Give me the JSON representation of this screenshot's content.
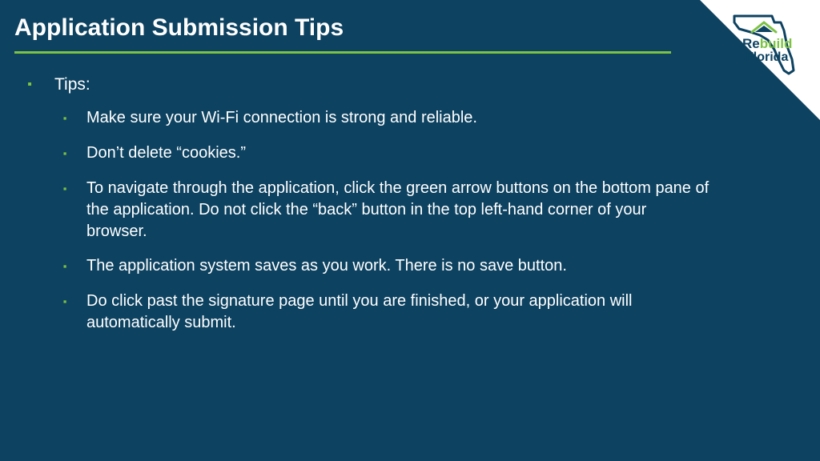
{
  "title": "Application Submission Tips",
  "logo": {
    "line1_a": "Re",
    "line1_b": "build",
    "line2": "Florida"
  },
  "colors": {
    "background": "#0d4261",
    "accent": "#7cc243",
    "text": "#ffffff",
    "logo_dark": "#0d4261",
    "logo_green": "#7cc243"
  },
  "list": {
    "heading": "Tips:",
    "items": [
      "Make sure your Wi-Fi connection is strong and reliable.",
      "Don’t delete “cookies.”",
      "To navigate through the application, click the green arrow buttons on the bottom pane of the application. Do not click the “back” button in the top left-hand corner of your browser.",
      "The application system saves as you work. There is no save button.",
      "Do click past the signature page until you are finished, or your application will automatically submit."
    ]
  }
}
